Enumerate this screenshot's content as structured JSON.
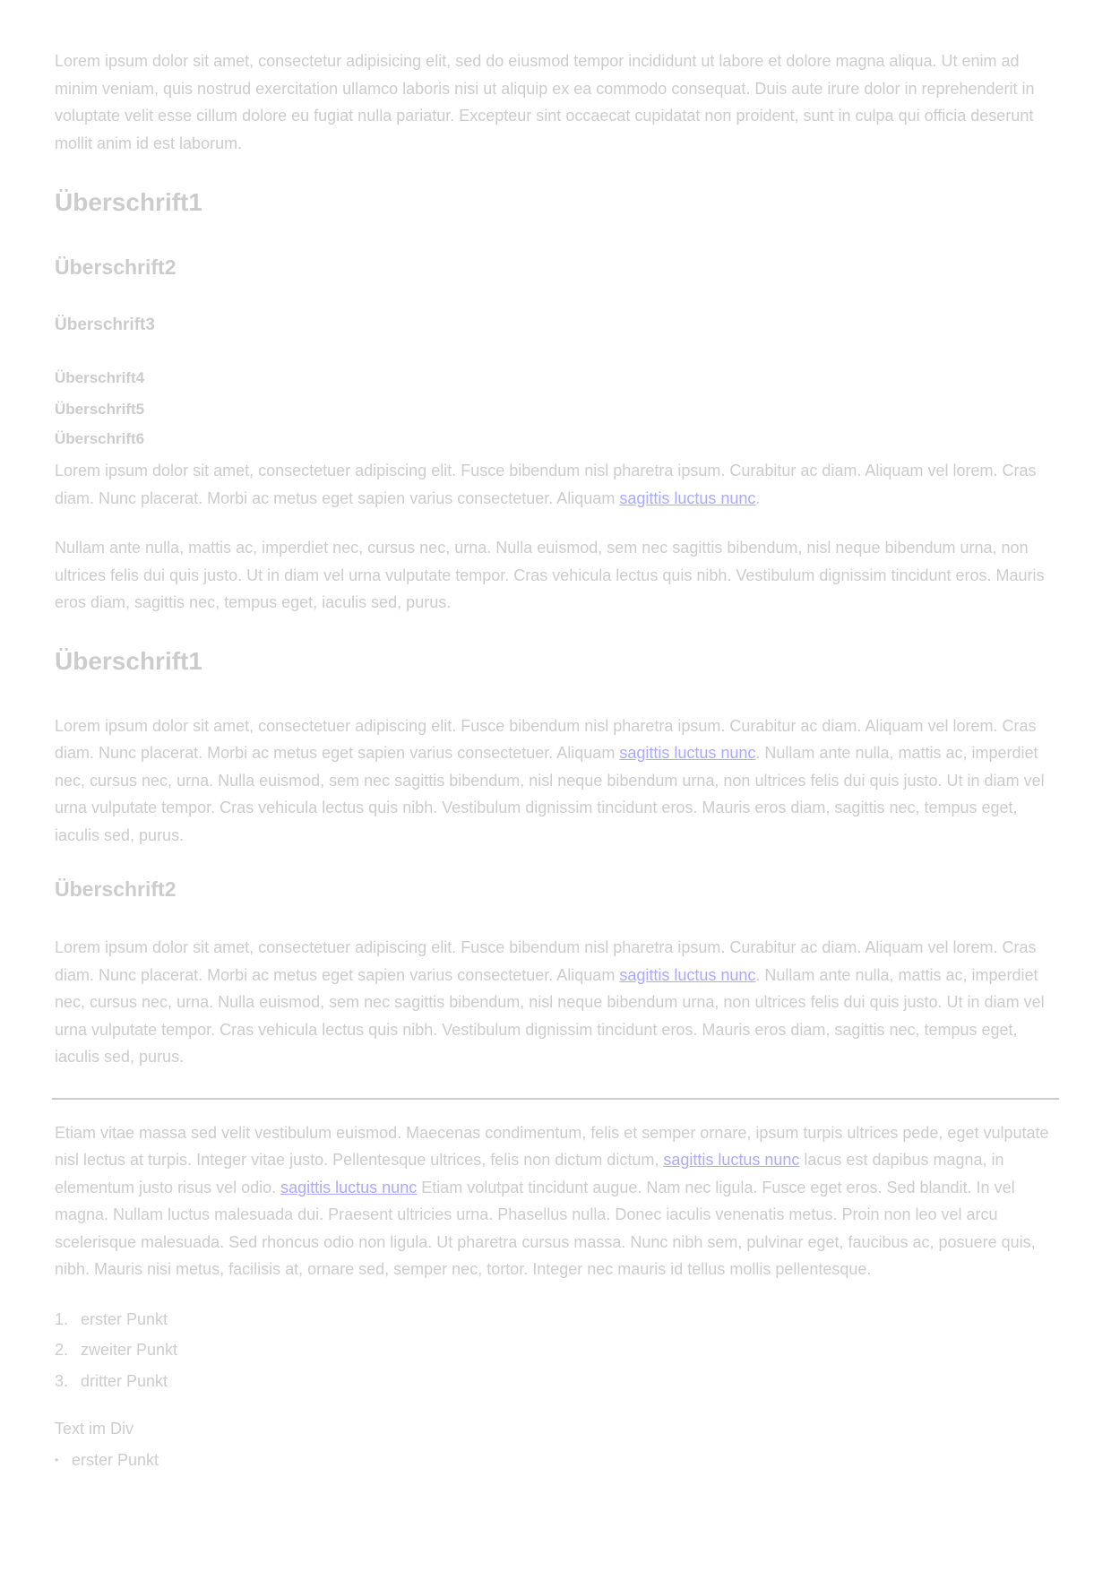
{
  "intro": "Lorem ipsum dolor sit amet, consectetur adipisicing elit, sed do eiusmod tempor incididunt ut labore et dolore magna aliqua. Ut enim ad minim veniam, quis nostrud exercitation ullamco laboris nisi ut aliquip ex ea commodo consequat. Duis aute irure dolor in reprehenderit in voluptate velit esse cillum dolore eu fugiat nulla pariatur. Excepteur sint occaecat cupidatat non proident, sunt in culpa qui officia deserunt mollit anim id est laborum.",
  "headings": {
    "h1": "Überschrift1",
    "h2": "Überschrift2",
    "h3": "Überschrift3",
    "h4": "Überschrift4",
    "h5": "Überschrift5",
    "h6": "Überschrift6"
  },
  "p2": {
    "text": "Lorem ipsum dolor sit amet, consectetuer adipiscing elit. Fusce bibendum nisl pharetra ipsum. Curabitur ac diam. Aliquam vel lorem. Cras diam. Nunc placerat. Morbi ac metus eget sapien varius consectetuer. Aliquam ",
    "link": "sagittis luctus nunc",
    "after": "."
  },
  "p3": "Nullam ante nulla, mattis ac, imperdiet nec, cursus nec, urna. Nulla euismod, sem nec sagittis bibendum, nisl neque bibendum urna, non ultrices felis dui quis justo. Ut in diam vel urna vulputate tempor. Cras vehicula lectus quis nibh. Vestibulum dignissim tincidunt eros. Mauris eros diam, sagittis nec, tempus eget, iaculis sed, purus.",
  "section1": {
    "heading": "Überschrift1",
    "before": "Lorem ipsum dolor sit amet, consectetuer adipiscing elit. Fusce bibendum nisl pharetra ipsum. Curabitur ac diam. Aliquam vel lorem. Cras diam. Nunc placerat. Morbi ac metus eget sapien varius consectetuer. Aliquam ",
    "link": "sagittis luctus nunc",
    "after": ". Nullam ante nulla, mattis ac, imperdiet nec, cursus nec, urna. Nulla euismod, sem nec sagittis bibendum, nisl neque bibendum urna, non ultrices felis dui quis justo. Ut in diam vel urna vulputate tempor. Cras vehicula lectus quis nibh. Vestibulum dignissim tincidunt eros. Mauris eros diam, sagittis nec, tempus eget, iaculis sed, purus."
  },
  "section2": {
    "heading": "Überschrift2",
    "before": "Lorem ipsum dolor sit amet, consectetuer adipiscing elit. Fusce bibendum nisl pharetra ipsum. Curabitur ac diam. Aliquam vel lorem. Cras diam. Nunc placerat. Morbi ac metus eget sapien varius consectetuer. Aliquam ",
    "link": "sagittis luctus nunc",
    "after": ". Nullam ante nulla, mattis ac, imperdiet nec, cursus nec, urna. Nulla euismod, sem nec sagittis bibendum, nisl neque bibendum urna, non ultrices felis dui quis justo. Ut in diam vel urna vulputate tempor. Cras vehicula lectus quis nibh. Vestibulum dignissim tincidunt eros. Mauris eros diam, sagittis nec, tempus eget, iaculis sed, purus."
  },
  "p4": {
    "a": "Etiam vitae massa sed velit vestibulum euismod. Maecenas condimentum, felis et semper ornare, ipsum turpis ultrices pede, eget vulputate nisl lectus at turpis. Integer vitae justo. Pellentesque ultrices, felis non dictum dictum, ",
    "link1": "sagittis luctus nunc",
    "b": " lacus est dapibus magna, in elementum justo risus vel odio. ",
    "link2": "sagittis luctus nunc",
    "c": " Etiam volutpat tincidunt augue. Nam nec ligula. Fusce eget eros. Sed blandit. In vel magna. Nullam luctus malesuada dui. Praesent ultricies urna. Phasellus nulla. Donec iaculis venenatis metus. Proin non leo vel arcu scelerisque malesuada. Sed rhoncus odio non ligula. Ut pharetra cursus massa. Nunc nibh sem, pulvinar eget, faucibus ac, posuere quis, nibh. Mauris nisi metus, facilisis at, ornare sed, semper nec, tortor. Integer nec mauris id tellus mollis pellentesque."
  },
  "ordered_list": [
    {
      "num": "1.",
      "label": "erster Punkt"
    },
    {
      "num": "2.",
      "label": "zweiter Punkt"
    },
    {
      "num": "3.",
      "label": "dritter Punkt"
    }
  ],
  "div_text": "Text im Div",
  "bullet_list": [
    {
      "bullet": "•",
      "label": "erster Punkt"
    }
  ],
  "colors": {
    "text": "#cccccc",
    "link": "#aaaaff",
    "rule": "#cccccc"
  }
}
